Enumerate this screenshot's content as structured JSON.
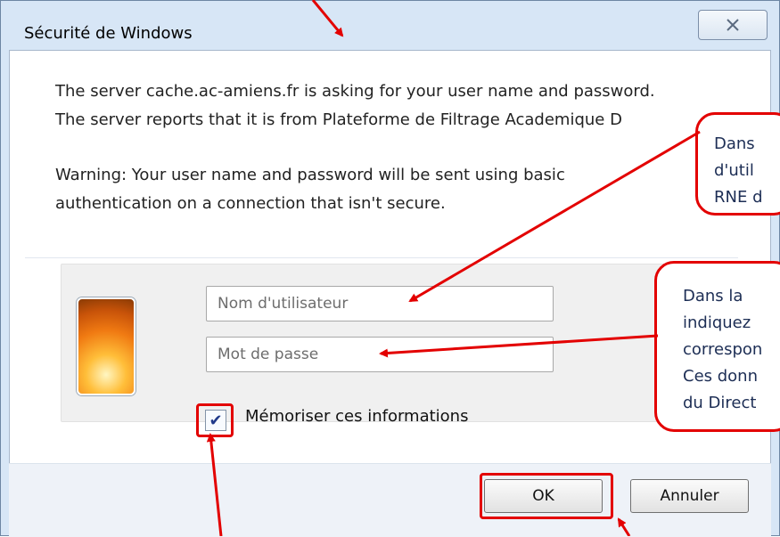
{
  "dialog": {
    "title": "Sécurité de Windows",
    "message_line1": "The server cache.ac-amiens.fr is asking for your user name and password.",
    "message_line2": "The server reports that it is from Plateforme de Filtrage Academique D",
    "warning_line1": "Warning: Your user name and password will be sent using basic",
    "warning_line2": "authentication on a connection that isn't secure."
  },
  "credentials": {
    "username_placeholder": "Nom d'utilisateur",
    "password_placeholder": "Mot de passe",
    "remember_label": "Mémoriser ces informations",
    "remember_checked": true
  },
  "buttons": {
    "ok": "OK",
    "cancel": "Annuler"
  },
  "callouts": {
    "username_hint": [
      "Dans",
      "d'util",
      "RNE d"
    ],
    "password_hint": [
      "Dans la",
      "indiquez",
      "correspon",
      "Ces donn",
      "du Direct"
    ]
  },
  "colors": {
    "annotation_red": "#e30000",
    "window_frame": "#d7e6f6"
  },
  "icons": {
    "close": "close-icon",
    "avatar": "user-avatar-flower",
    "checkbox": "checkmark-icon"
  }
}
